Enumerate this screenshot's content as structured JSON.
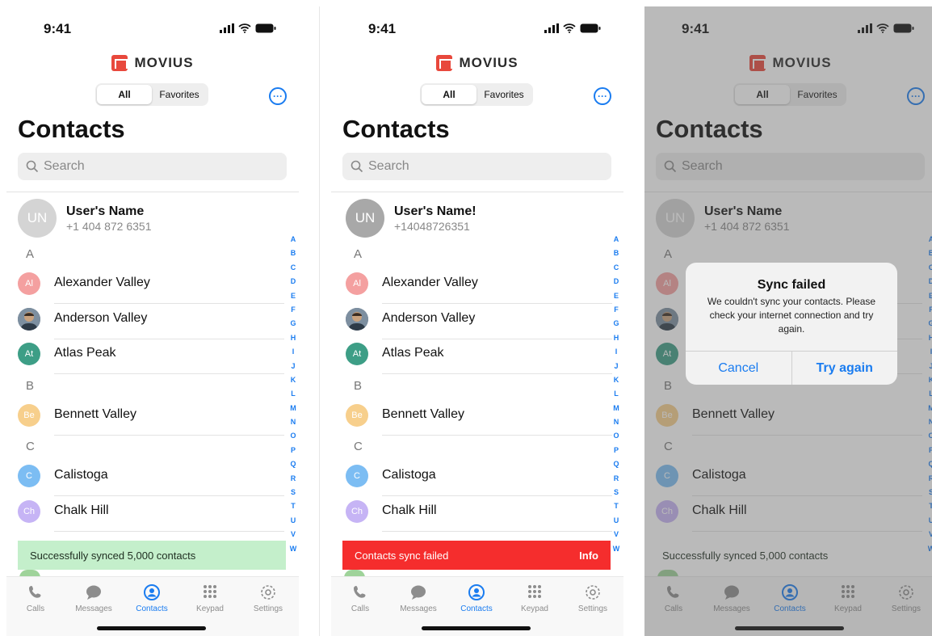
{
  "status": {
    "time": "9:41"
  },
  "brand": {
    "name": "MOVIUS",
    "color": "#e8483c"
  },
  "segment": {
    "all": "All",
    "favorites": "Favorites"
  },
  "title": "Contacts",
  "search_placeholder": "Search",
  "colors": {
    "accent": "#1a7cf0",
    "success_bg": "#c4efcb",
    "error_bg": "#f52d2d"
  },
  "screens": [
    {
      "me": {
        "initials": "UN",
        "name": "User's Name",
        "phone": "+1 404 872 6351"
      },
      "banner": {
        "text": "Successfully synced 5,000 contacts",
        "action": ""
      }
    },
    {
      "me": {
        "initials": "UN",
        "name": "User's Name!",
        "phone": "+14048726351"
      },
      "banner": {
        "text": "Contacts sync failed",
        "action": "Info"
      }
    },
    {
      "me": {
        "initials": "UN",
        "name": "User's Name",
        "phone": "+1 404 872 6351"
      },
      "banner": {
        "text": "Successfully synced 5,000 contacts",
        "action": ""
      },
      "alert": {
        "title": "Sync failed",
        "message": "We couldn't sync your contacts. Please check your internet connection and try again.",
        "cancel": "Cancel",
        "retry": "Try again"
      }
    }
  ],
  "sections": [
    {
      "letter": "A",
      "contacts": [
        {
          "initials": "Al",
          "name": "Alexander Valley",
          "color": "#f4a0a0"
        },
        {
          "initials": "",
          "name": "Anderson Valley",
          "color": "#6b7b8c",
          "photo": true
        },
        {
          "initials": "At",
          "name": "Atlas Peak",
          "color": "#3d9e86"
        }
      ]
    },
    {
      "letter": "B",
      "contacts": [
        {
          "initials": "Be",
          "name": "Bennett Valley",
          "color": "#f7cf8c"
        }
      ]
    },
    {
      "letter": "C",
      "contacts": [
        {
          "initials": "C",
          "name": "Calistoga",
          "color": "#7cbdf3"
        },
        {
          "initials": "Ch",
          "name": "Chalk Hill",
          "color": "#c6b4f5"
        }
      ]
    }
  ],
  "index_letters": [
    "A",
    "B",
    "C",
    "D",
    "E",
    "F",
    "G",
    "H",
    "I",
    "J",
    "K",
    "L",
    "M",
    "N",
    "O",
    "P",
    "Q",
    "R",
    "S",
    "T",
    "U",
    "V",
    "W"
  ],
  "tabs": [
    {
      "label": "Calls",
      "icon": "phone-icon"
    },
    {
      "label": "Messages",
      "icon": "chat-bubble-icon"
    },
    {
      "label": "Contacts",
      "icon": "person-circle-icon",
      "active": true
    },
    {
      "label": "Keypad",
      "icon": "keypad-icon"
    },
    {
      "label": "Settings",
      "icon": "gear-icon"
    }
  ]
}
